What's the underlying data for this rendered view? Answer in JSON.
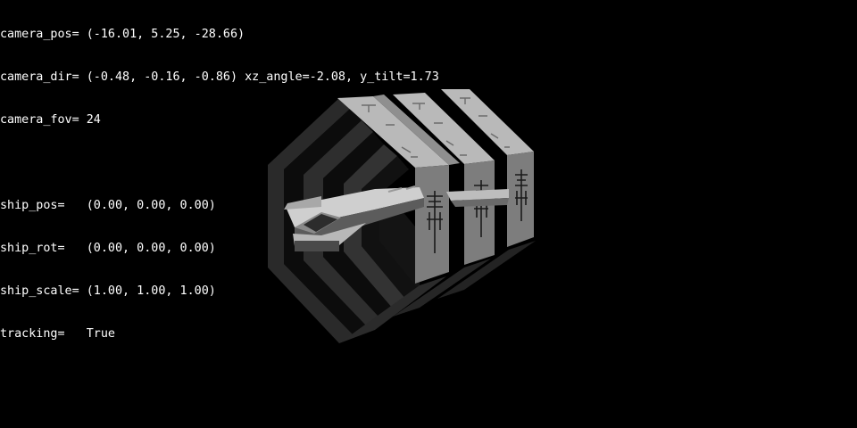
{
  "hud": {
    "camera_pos": "camera_pos= (-16.01, 5.25, -28.66)",
    "camera_dir": "camera_dir= (-0.48, -0.16, -0.86) xz_angle=-2.08, y_tilt=1.73",
    "camera_fov": "camera_fov= 24",
    "ship_pos": "ship_pos=   (0.00, 0.00, 0.00)",
    "ship_rot": "ship_rot=   (0.00, 0.00, 0.00)",
    "ship_scale": "ship_scale= (1.00, 1.00, 1.00)",
    "tracking": "tracking=   True"
  },
  "colors": {
    "background": "#000000",
    "hud_text": "#ffffff",
    "panel_light": "#b4b4b4",
    "panel_mid": "#7a7a7a",
    "panel_dark": "#3c3c3c",
    "ship_light": "#c8c8c8",
    "ship_dark": "#5a5a5a"
  }
}
